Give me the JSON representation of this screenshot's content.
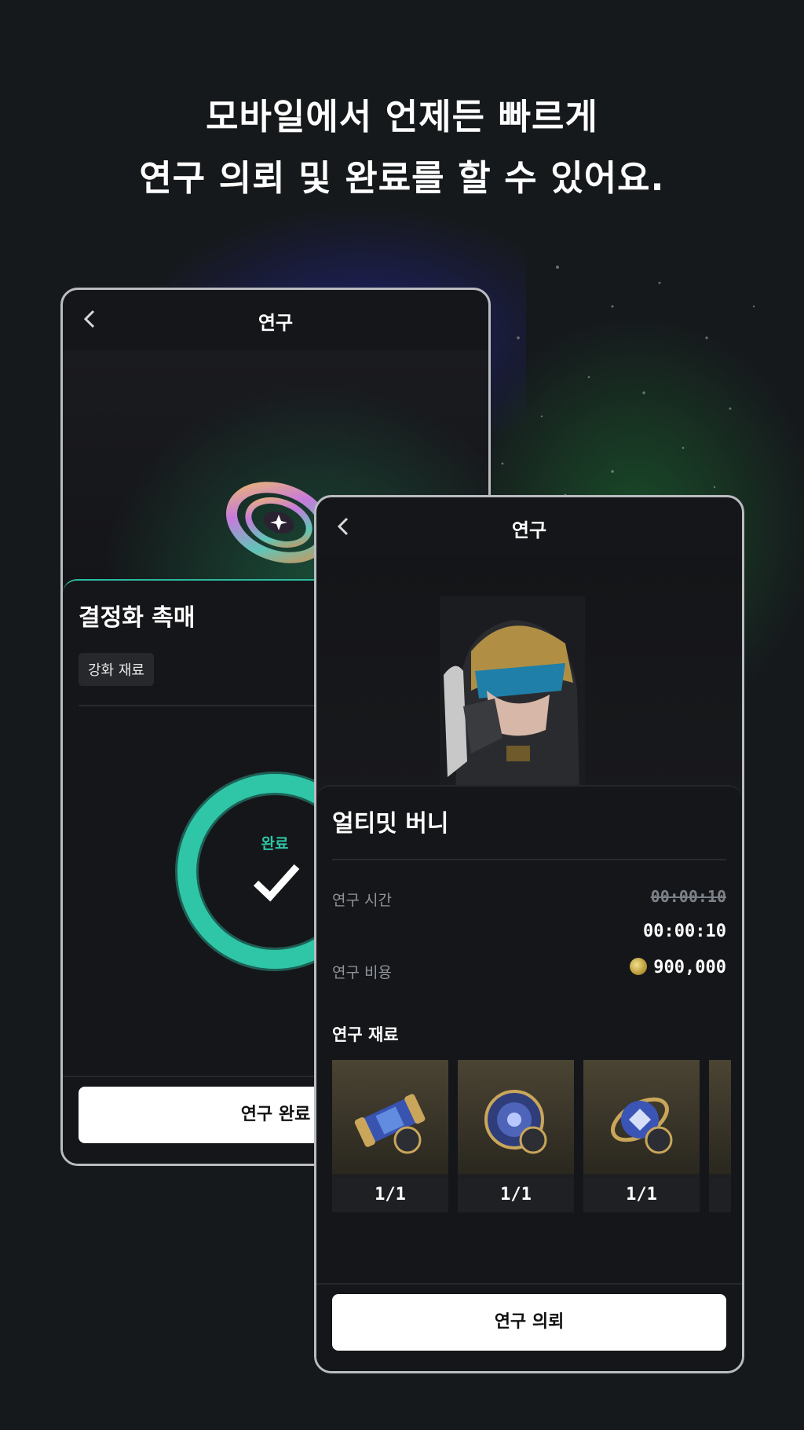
{
  "headline": {
    "line1": "모바일에서 언제든 빠르게",
    "line2": "연구 의뢰 및 완료를 할 수 있어요."
  },
  "back_screen": {
    "nav_title": "연구",
    "item_name": "결정화 촉매",
    "tag": "강화 재료",
    "status_label": "완료",
    "progress_fraction": 1.0,
    "button_label": "연구 완료",
    "accent_color": "#2ec6a6"
  },
  "front_screen": {
    "nav_title": "연구",
    "item_name": "얼티밋 버니",
    "research_time_label": "연구 시간",
    "research_time_original": "00:00:10",
    "research_time_value": "00:00:10",
    "research_cost_label": "연구 비용",
    "research_cost_value": "900,000",
    "materials_title": "연구 재료",
    "materials": [
      {
        "icon": "capsule-icon",
        "count": "1/1"
      },
      {
        "icon": "sphere-part-icon",
        "count": "1/1"
      },
      {
        "icon": "orb-part-icon",
        "count": "1/1"
      }
    ],
    "button_label": "연구 의뢰"
  }
}
